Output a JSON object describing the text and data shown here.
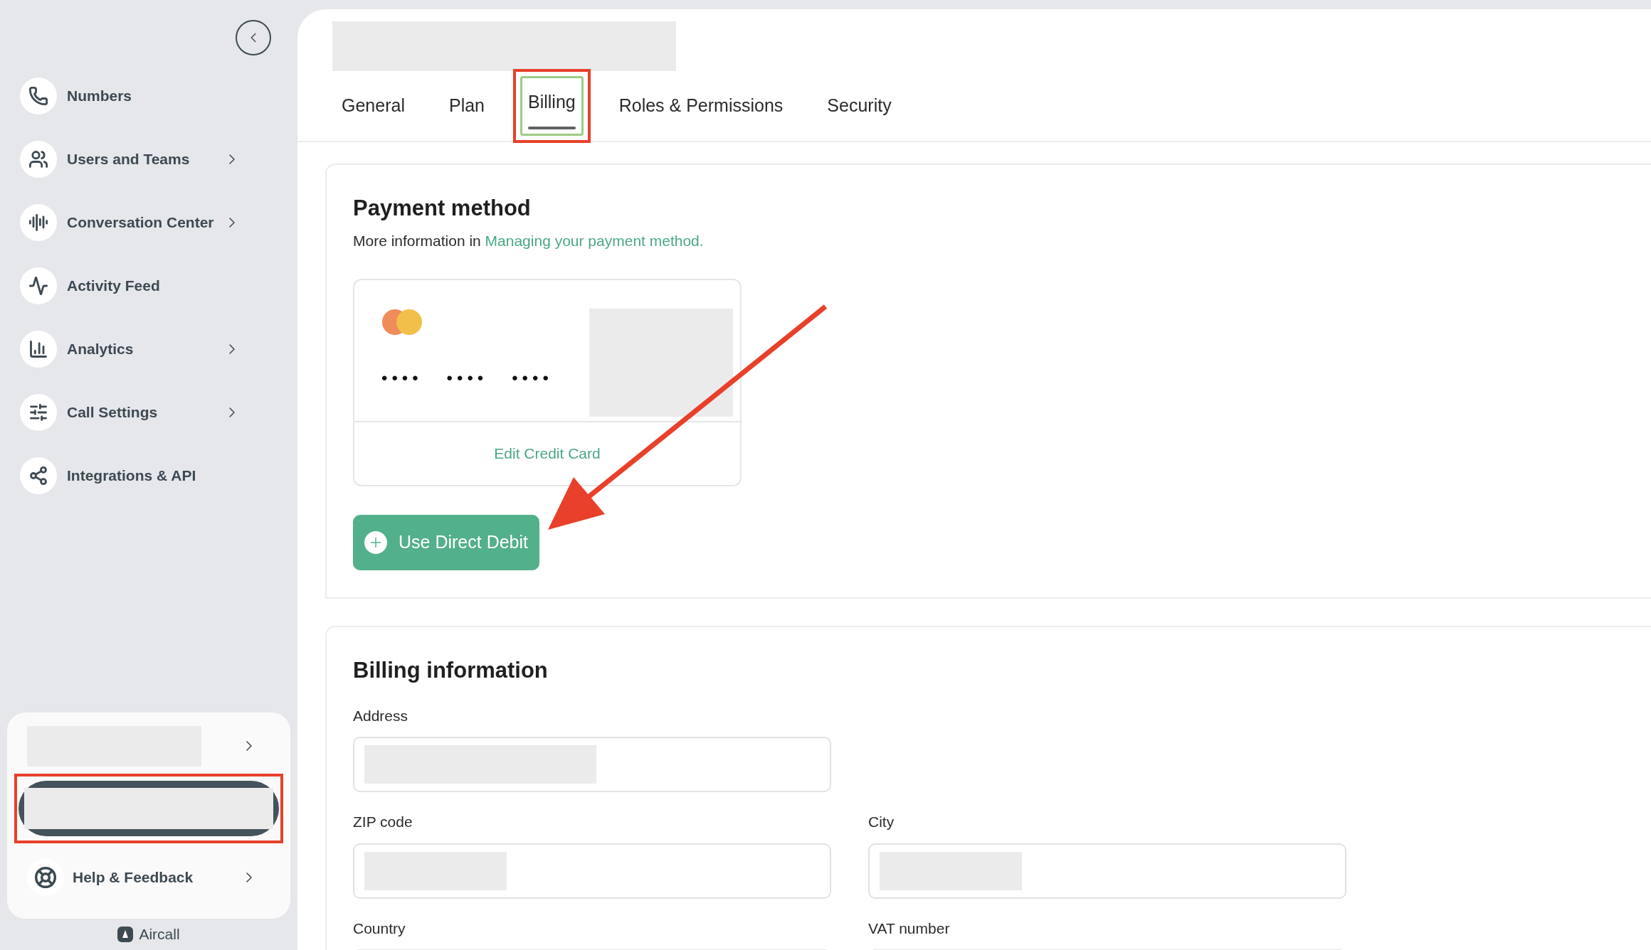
{
  "sidebar": {
    "items": [
      {
        "label": "Numbers",
        "expandable": false
      },
      {
        "label": "Users and Teams",
        "expandable": true
      },
      {
        "label": "Conversation Center",
        "expandable": true
      },
      {
        "label": "Activity Feed",
        "expandable": false
      },
      {
        "label": "Analytics",
        "expandable": true
      },
      {
        "label": "Call Settings",
        "expandable": true
      },
      {
        "label": "Integrations & API",
        "expandable": false
      }
    ],
    "footer": {
      "help": "Help & Feedback",
      "brand": "Aircall"
    }
  },
  "tabs": [
    {
      "label": "General",
      "selected": false
    },
    {
      "label": "Plan",
      "selected": false
    },
    {
      "label": "Billing",
      "selected": true
    },
    {
      "label": "Roles & Permissions",
      "selected": false
    },
    {
      "label": "Security",
      "selected": false
    }
  ],
  "payment": {
    "title": "Payment method",
    "intro": "More information in",
    "link": "Managing your payment method.",
    "card_groups": [
      "••••",
      "••••",
      "••••"
    ],
    "edit": "Edit Credit Card",
    "button": "Use Direct Debit"
  },
  "billing": {
    "title": "Billing information",
    "fields": [
      {
        "label": "Address"
      },
      {
        "label": "ZIP code"
      },
      {
        "label": "City"
      },
      {
        "label": "Country"
      },
      {
        "label": "VAT number"
      }
    ]
  }
}
